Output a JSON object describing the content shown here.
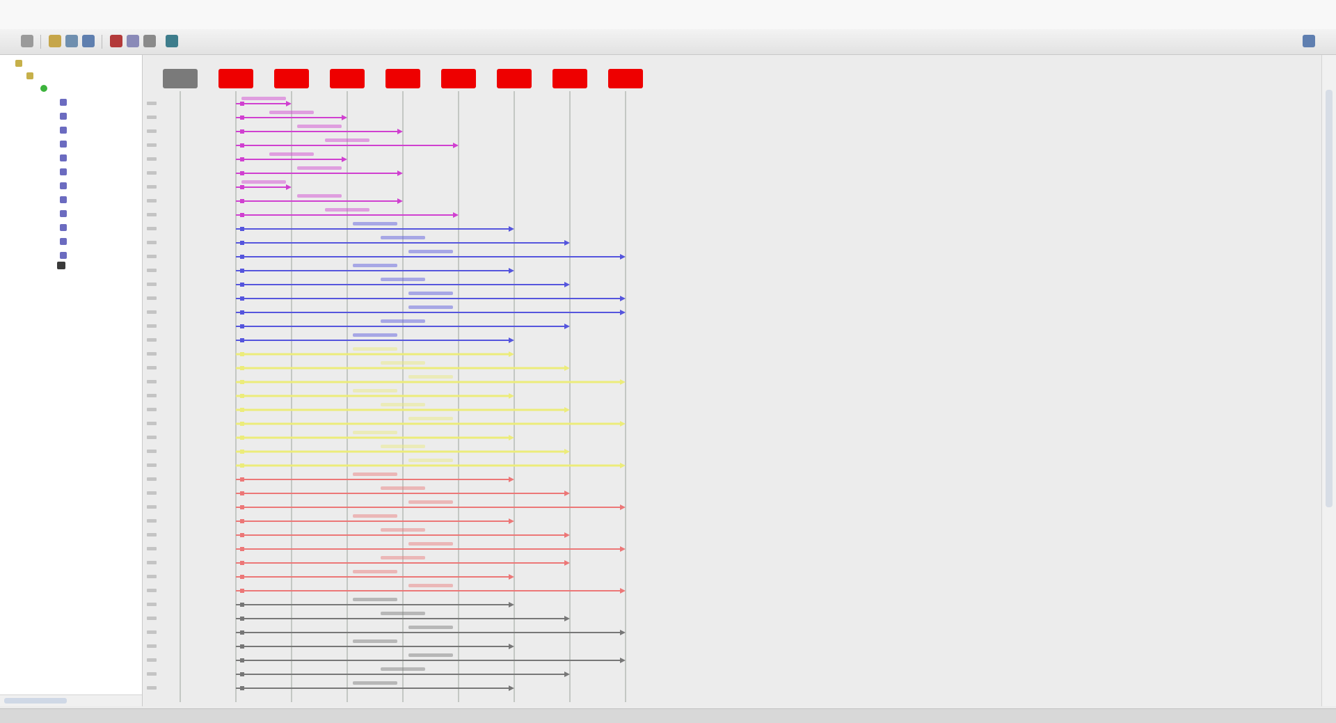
{
  "toolbar": {
    "icons": [
      "back-icon",
      "folder-icon",
      "save-icon",
      "print-icon",
      "stop-icon",
      "pause-icon",
      "settings-icon",
      "export-icon"
    ],
    "right_icon": "user-icon"
  },
  "tree": {
    "root": "",
    "child": "",
    "session": "",
    "items": [
      "",
      "",
      "",
      "",
      "",
      "",
      "",
      "",
      "",
      "",
      "",
      ""
    ],
    "selected": ""
  },
  "lifelines": {
    "count": 9,
    "header_colors": [
      "#7a7a7a",
      "#ee0000",
      "#ee0000",
      "#ee0000",
      "#ee0000",
      "#ee0000",
      "#ee0000",
      "#ee0000",
      "#ee0000"
    ]
  },
  "colors": {
    "magenta": "#d040d0",
    "blue": "#5555dd",
    "yellow": "#ecec7a",
    "red": "#ec7777",
    "gray": "#777777"
  },
  "messages": [
    {
      "from": 1,
      "to": 2,
      "color": "magenta"
    },
    {
      "from": 1,
      "to": 3,
      "color": "magenta"
    },
    {
      "from": 1,
      "to": 4,
      "color": "magenta"
    },
    {
      "from": 1,
      "to": 5,
      "color": "magenta"
    },
    {
      "from": 1,
      "to": 3,
      "color": "magenta"
    },
    {
      "from": 1,
      "to": 4,
      "color": "magenta"
    },
    {
      "from": 1,
      "to": 2,
      "color": "magenta"
    },
    {
      "from": 1,
      "to": 4,
      "color": "magenta"
    },
    {
      "from": 1,
      "to": 5,
      "color": "magenta"
    },
    {
      "from": 1,
      "to": 6,
      "color": "blue"
    },
    {
      "from": 1,
      "to": 7,
      "color": "blue"
    },
    {
      "from": 1,
      "to": 8,
      "color": "blue"
    },
    {
      "from": 1,
      "to": 6,
      "color": "blue"
    },
    {
      "from": 1,
      "to": 7,
      "color": "blue"
    },
    {
      "from": 1,
      "to": 8,
      "color": "blue"
    },
    {
      "from": 1,
      "to": 8,
      "color": "blue"
    },
    {
      "from": 1,
      "to": 7,
      "color": "blue"
    },
    {
      "from": 1,
      "to": 6,
      "color": "blue"
    },
    {
      "from": 1,
      "to": 6,
      "color": "yellow"
    },
    {
      "from": 1,
      "to": 7,
      "color": "yellow"
    },
    {
      "from": 1,
      "to": 8,
      "color": "yellow"
    },
    {
      "from": 1,
      "to": 6,
      "color": "yellow"
    },
    {
      "from": 1,
      "to": 7,
      "color": "yellow"
    },
    {
      "from": 1,
      "to": 8,
      "color": "yellow"
    },
    {
      "from": 1,
      "to": 6,
      "color": "yellow"
    },
    {
      "from": 1,
      "to": 7,
      "color": "yellow"
    },
    {
      "from": 1,
      "to": 8,
      "color": "yellow"
    },
    {
      "from": 1,
      "to": 6,
      "color": "red"
    },
    {
      "from": 1,
      "to": 7,
      "color": "red"
    },
    {
      "from": 1,
      "to": 8,
      "color": "red"
    },
    {
      "from": 1,
      "to": 6,
      "color": "red"
    },
    {
      "from": 1,
      "to": 7,
      "color": "red"
    },
    {
      "from": 1,
      "to": 8,
      "color": "red"
    },
    {
      "from": 1,
      "to": 7,
      "color": "red"
    },
    {
      "from": 1,
      "to": 6,
      "color": "red"
    },
    {
      "from": 1,
      "to": 8,
      "color": "red"
    },
    {
      "from": 1,
      "to": 6,
      "color": "gray"
    },
    {
      "from": 1,
      "to": 7,
      "color": "gray"
    },
    {
      "from": 1,
      "to": 8,
      "color": "gray"
    },
    {
      "from": 1,
      "to": 6,
      "color": "gray"
    },
    {
      "from": 1,
      "to": 8,
      "color": "gray"
    },
    {
      "from": 1,
      "to": 7,
      "color": "gray"
    },
    {
      "from": 1,
      "to": 6,
      "color": "gray"
    }
  ]
}
